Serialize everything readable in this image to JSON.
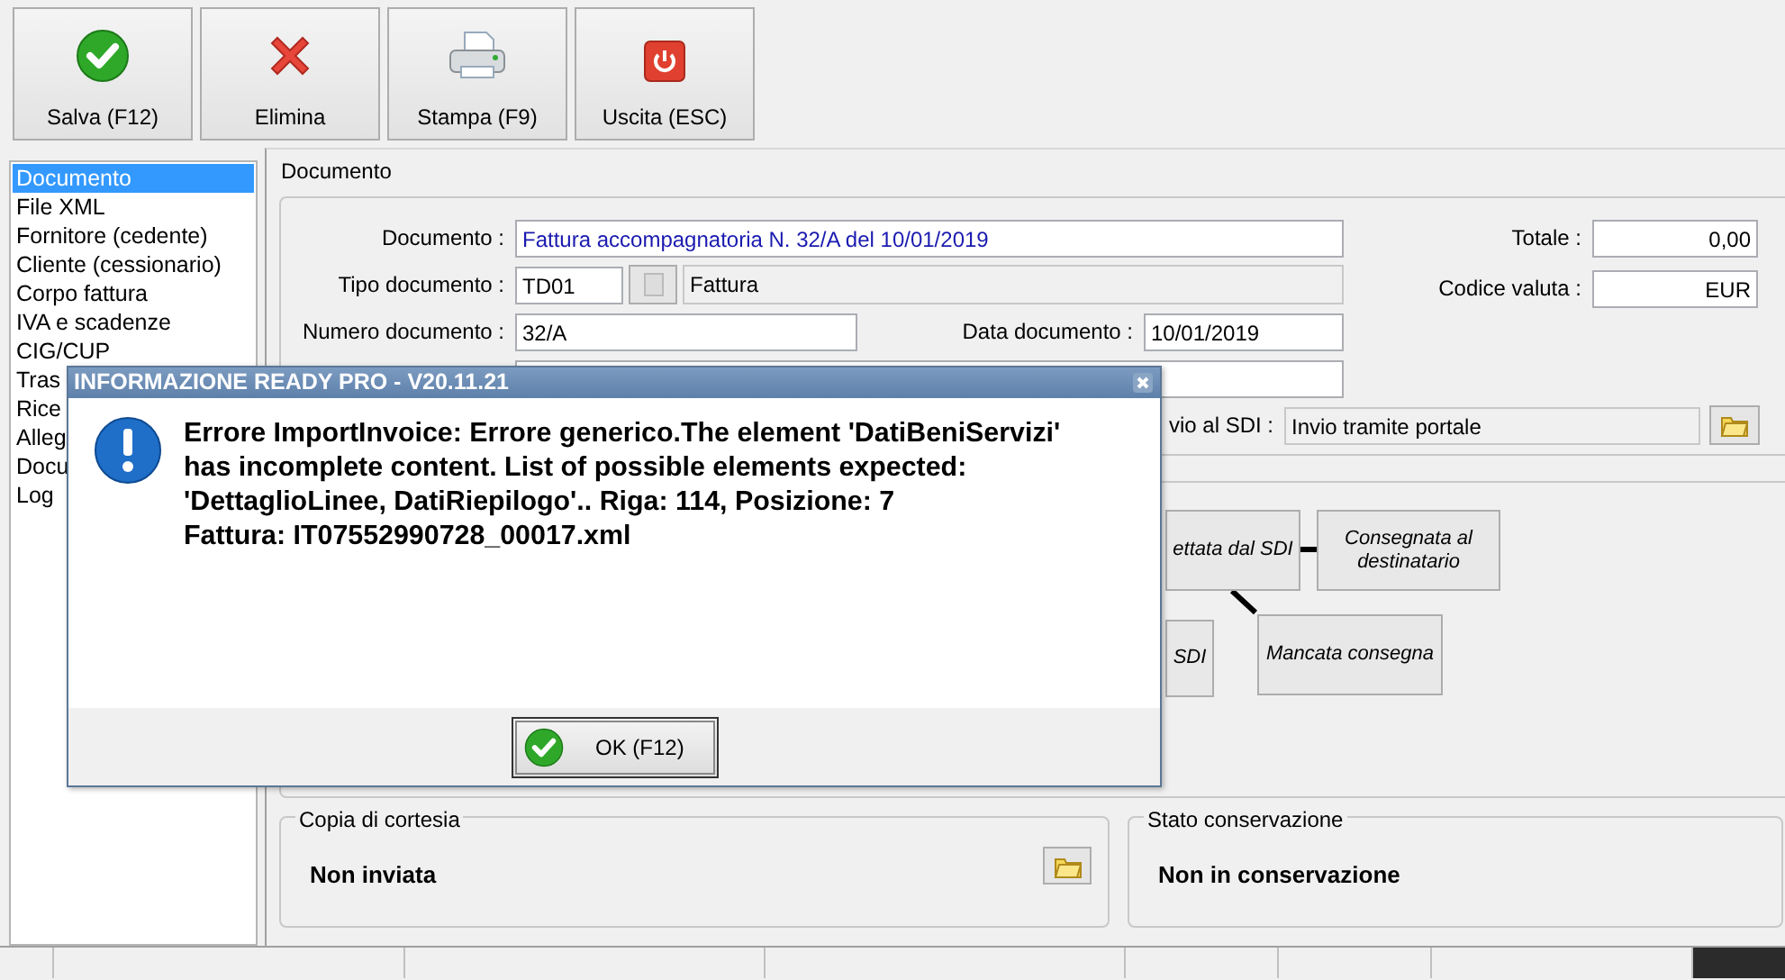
{
  "toolbar": [
    {
      "label": "Salva (F12)",
      "kind": "save"
    },
    {
      "label": "Elimina",
      "kind": "delete"
    },
    {
      "label": "Stampa (F9)",
      "kind": "print"
    },
    {
      "label": "Uscita (ESC)",
      "kind": "exit"
    }
  ],
  "sidebar": {
    "items": [
      {
        "label": "Documento",
        "selected": true
      },
      {
        "label": "File XML",
        "selected": false
      },
      {
        "label": "Fornitore (cedente)",
        "selected": false
      },
      {
        "label": "Cliente (cessionario)",
        "selected": false
      },
      {
        "label": "Corpo fattura",
        "selected": false
      },
      {
        "label": "IVA e scadenze",
        "selected": false
      },
      {
        "label": "CIG/CUP",
        "selected": false
      },
      {
        "label": "Tras",
        "selected": false
      },
      {
        "label": "Rice",
        "selected": false
      },
      {
        "label": "Alleg",
        "selected": false
      },
      {
        "label": "Docu",
        "selected": false
      },
      {
        "label": "Log",
        "selected": false
      }
    ]
  },
  "section_title": "Documento",
  "form": {
    "documento": {
      "label": "Documento :",
      "value": "Fattura accompagnatoria N. 32/A del 10/01/2019"
    },
    "tipo_documento": {
      "label": "Tipo documento :",
      "code": "TD01",
      "description": "Fattura"
    },
    "numero_documento": {
      "label": "Numero documento :",
      "value": "32/A"
    },
    "data_documento": {
      "label": "Data documento :",
      "value": "10/01/2019"
    },
    "invio_sdi": {
      "label": "vio al SDI :",
      "value": "Invio tramite portale"
    },
    "totale": {
      "label": "Totale :",
      "value": "0,00"
    },
    "codice_valuta": {
      "label": "Codice valuta :",
      "value": "EUR"
    }
  },
  "status_flow": {
    "nodes": [
      {
        "label": "ettata dal SDI"
      },
      {
        "label": "Consegnata al destinatario"
      },
      {
        "label": "SDI"
      },
      {
        "label": "Mancata consegna"
      }
    ]
  },
  "courtesy_copy": {
    "title": "Copia di cortesia",
    "status": "Non inviata"
  },
  "conservation": {
    "title": "Stato conservazione",
    "status": "Non in conservazione"
  },
  "dialog": {
    "title": "INFORMAZIONE READY PRO - V20.11.21",
    "message_lines": [
      "Errore ImportInvoice: Errore generico.The element 'DatiBeniServizi'",
      "has incomplete content. List of possible elements expected:",
      "'DettaglioLinee, DatiRiepilogo'.. Riga: 114, Posizione: 7",
      "Fattura: IT07552990728_00017.xml"
    ],
    "ok_button": "OK (F12)"
  }
}
